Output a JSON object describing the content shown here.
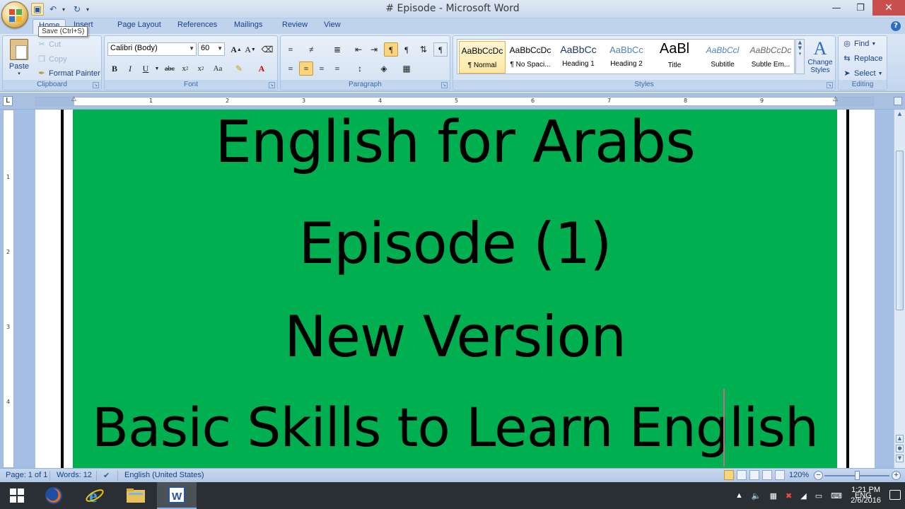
{
  "window": {
    "title": "# Episode - Microsoft Word",
    "minimize_icon": "minimize-icon",
    "restore_icon": "restore-icon",
    "close_icon": "close-icon"
  },
  "quick_access": {
    "save_tooltip": "Save (Ctrl+S)"
  },
  "tabs": [
    {
      "label": "Home"
    },
    {
      "label": "Insert"
    },
    {
      "label": "Page Layout"
    },
    {
      "label": "References"
    },
    {
      "label": "Mailings"
    },
    {
      "label": "Review"
    },
    {
      "label": "View"
    }
  ],
  "ribbon": {
    "clipboard": {
      "paste": "Paste",
      "cut": "Cut",
      "copy": "Copy",
      "format_painter": "Format Painter",
      "label": "Clipboard"
    },
    "font": {
      "font_name": "Calibri (Body)",
      "font_size": "60",
      "label": "Font"
    },
    "paragraph": {
      "label": "Paragraph"
    },
    "styles": {
      "label": "Styles",
      "items": [
        {
          "preview": "AaBbCcDc",
          "name": "¶ Normal"
        },
        {
          "preview": "AaBbCcDc",
          "name": "¶ No Spaci..."
        },
        {
          "preview": "AaBbCc",
          "name": "Heading 1"
        },
        {
          "preview": "AaBbCc",
          "name": "Heading 2"
        },
        {
          "preview": "AaBl",
          "name": "Title"
        },
        {
          "preview": "AaBbCcl",
          "name": "Subtitle"
        },
        {
          "preview": "AaBbCcDc",
          "name": "Subtle Em..."
        }
      ],
      "change_styles": "Change Styles"
    },
    "editing": {
      "find": "Find",
      "replace": "Replace",
      "select": "Select",
      "label": "Editing"
    }
  },
  "ruler_numbers": [
    "1",
    "2",
    "3",
    "4",
    "5",
    "6",
    "7",
    "8",
    "9"
  ],
  "vruler_numbers": [
    "1",
    "2",
    "3",
    "4"
  ],
  "document": {
    "background_color": "#00b050",
    "lines": [
      "English for Arabs",
      "Episode (1)",
      "New Version",
      "Basic Skills to Learn English"
    ]
  },
  "statusbar": {
    "page": "Page: 1 of 1",
    "words": "Words: 12",
    "language": "English (United States)",
    "zoom": "120%"
  },
  "taskbar": {
    "language": "ENG",
    "time": "1:21 PM",
    "date": "2/6/2016"
  }
}
